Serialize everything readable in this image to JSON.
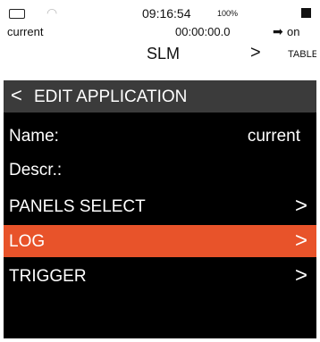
{
  "status": {
    "time": "09:16:54",
    "battery_percent": "100%",
    "label": "current",
    "timer": "00:00:00.0",
    "state": "on"
  },
  "nav": {
    "mode": "SLM",
    "next_arrow": ">",
    "next_label": "TABLE"
  },
  "header": {
    "back_icon": "<",
    "title": "EDIT APPLICATION"
  },
  "fields": {
    "name_label": "Name:",
    "name_value": "current",
    "descr_label": "Descr.:"
  },
  "menu": [
    {
      "label": "PANELS SELECT",
      "chev": ">",
      "active": false
    },
    {
      "label": "LOG",
      "chev": ">",
      "active": true
    },
    {
      "label": "TRIGGER",
      "chev": ">",
      "active": false
    }
  ],
  "colors": {
    "active_row": "#e8532a",
    "header_bg": "#3b3b3b",
    "screen_bg": "#000000"
  }
}
